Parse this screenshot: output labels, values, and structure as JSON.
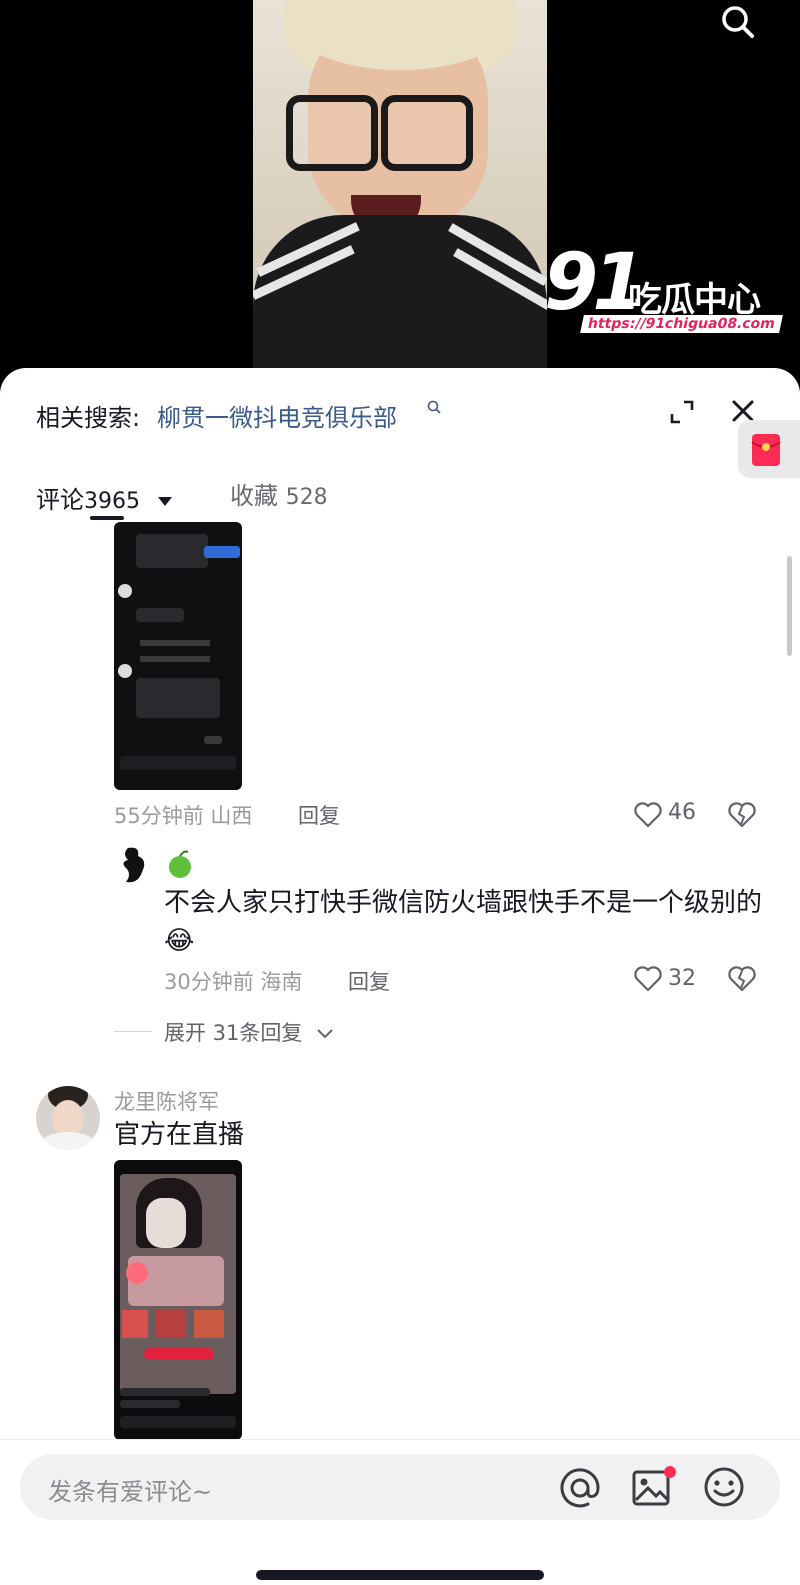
{
  "header": {
    "watermark_num": "91",
    "watermark_text": "吃瓜中心",
    "watermark_url": "https://91chigua08.com"
  },
  "icons": [
    "search-icon",
    "expand-icon",
    "close-icon",
    "red-packet-icon",
    "heart-icon",
    "broken-heart-icon",
    "apple-icon",
    "emoji-icon",
    "at-icon",
    "image-icon",
    "chevron-down-icon",
    "triangle-down-icon"
  ],
  "sheet": {
    "related_label": "相关搜索:",
    "related_query": "柳贯一微抖电竞俱乐部",
    "tabs": {
      "comments_label": "评论",
      "comments_count": "3965",
      "favorites_label": "收藏",
      "favorites_count": "528"
    }
  },
  "comments": [
    {
      "meta": "55分钟前 山西",
      "reply_label": "回复",
      "likes": "46"
    },
    {
      "reply_text": "不会人家只打快手微信防火墙跟快手不是一个级别的",
      "emoji": "😂",
      "meta": "30分钟前 海南",
      "reply_label": "回复",
      "likes": "32"
    },
    {
      "username": "龙里陈将军",
      "text": "官方在直播"
    }
  ],
  "expand_replies": "展开 31条回复",
  "input": {
    "placeholder": "发条有爱评论~"
  },
  "colors": {
    "link": "#3a5a8c",
    "accent_red": "#fe2c55",
    "text_primary": "#161823",
    "text_secondary": "#9a9ba1"
  }
}
